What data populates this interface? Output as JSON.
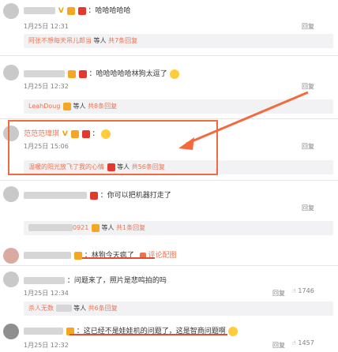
{
  "comments": [
    {
      "text": "：哈哈哈哈哈",
      "time": "1月25日 12:31",
      "reply": "回复",
      "sub": {
        "user": "阿张不想每天吊儿郎当",
        "mid": " 等人 ",
        "count": "共7条回复"
      }
    },
    {
      "text": "：哈哈哈哈哈林狗太逗了",
      "time": "1月25日 12:32",
      "reply": "回复",
      "sub": {
        "user": "LeahDoug",
        "mid": " 等人 ",
        "count": "共8条回复"
      }
    },
    {
      "name": "范范范瑋琪",
      "text": "：",
      "time": "1月25日 15:06",
      "reply": "回复",
      "sub": {
        "user": "温暖的阳光放飞了我的心情",
        "mid": " 等人 ",
        "count": "共56条回复"
      }
    },
    {
      "text": "：你可以把机器打走了",
      "time": "",
      "reply": "回复",
      "sub": {
        "user": "0921",
        "mid": " 等人 ",
        "count": "共1条回复"
      }
    },
    {
      "text": "：林狗今天疯了",
      "extra": "评论配图",
      "time": "",
      "reply": ""
    },
    {
      "text": "：问题来了，照片是悲鸣拍的吗",
      "time": "1月25日 12:34",
      "reply": "回复",
      "likes": "1746",
      "sub": {
        "user": "杀人无数",
        "mid": " 等人 ",
        "count": "共6条回复"
      }
    },
    {
      "text": "：这已经不是娃娃机的问题了，这是智商问题啊",
      "time": "1月25日 12:32",
      "reply": "回复",
      "likes": "1457"
    }
  ],
  "icons": {
    "v_badge": "V",
    "emoji": "smiley-face",
    "like": "thumbs-up"
  },
  "colors": {
    "accent": "#eb7350",
    "highlight": "#f26a3d",
    "link": "#eb7350",
    "bg_sub": "#f2f2f5"
  }
}
